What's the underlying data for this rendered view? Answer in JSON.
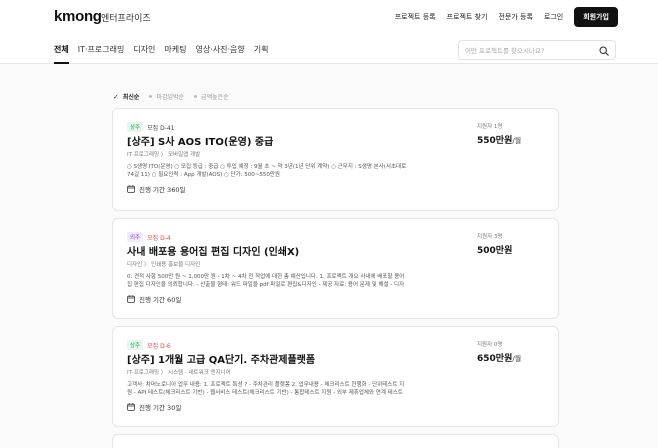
{
  "header": {
    "logo": "kmong",
    "logo_sub": "엔터프라이즈",
    "nav": [
      "프로젝트 등록",
      "프로젝트 찾기",
      "전문가 등록",
      "로그인"
    ],
    "signup": "회원가입"
  },
  "categories": [
    "전체",
    "IT·프로그래밍",
    "디자인",
    "마케팅",
    "영상·사진·음향",
    "기획"
  ],
  "search": {
    "placeholder": "어떤 프로젝트를 찾으시나요?"
  },
  "sort": [
    "최신순",
    "마감임박순",
    "금액높은순"
  ],
  "colors": {
    "accent": "#111111",
    "green": "#17a34a",
    "purple": "#8b3fd9",
    "red": "#e5484d"
  },
  "projects": [
    {
      "badge": "상주",
      "badge_color": "green",
      "dday": "모집 D-41",
      "dday_red": false,
      "title": "[상주] S사 AOS ITO(운영) 중급",
      "category": "IT·프로그래밍 〉 모바일앱 개발",
      "desc": "○ S생명 ITO(운영) ○ 모집 등급 : 중급 ○ 투입 예정 : 9월 초 ~ 약 3년(1년 단위 계약) ○ 근무지 : S생명 본사(서초대로 74길 11) ○ 필요인력 : App 개발(AOS) ○ 단가: 500~550만원",
      "period": "진행 기간 360일",
      "applicants": "지원자 1명",
      "price": "550만원",
      "price_unit": "/월"
    },
    {
      "badge": "외주",
      "badge_color": "purple",
      "dday": "모집 D-4",
      "dday_red": true,
      "title": "사내 배포용 용어집 편집 디자인 (인쇄X)",
      "category": "디자인 〉 인쇄용 홍보물 디자인",
      "desc": "0. 견적 사항 500만 원 ~ 1,000만 원 - 1차 ~ 4차 전 작업에 대한 총 예산입니다. 1. 프로젝트 개요 사내에 배포할 용어집 편집 디자인을 의뢰합니다. - 산출물 형태: 워드 파일을 pdf 파일로 편집&디자인 - 제공 자료: 용어 문제 및 해설 - 디자인 ...",
      "period": "진행 기간 60일",
      "applicants": "지원자 3명",
      "price": "500만원",
      "price_unit": ""
    },
    {
      "badge": "상주",
      "badge_color": "green",
      "dday": "모집 D-6",
      "dday_red": true,
      "title": "[상주] 1개월 고급 QA단기. 주차관제플랫폼",
      "category": "IT·프로그래밍 〉 시스템 · 네트워크 엔지니어",
      "desc": "고객사: 차머노로니아 업무 내용: 1. 프로젝트 특성 ? - 주차관리 플랫폼 2. 업무내용 - 체크리스트 현행화 - 단위테스트 지원 - API 테스트(체크리스트 기반) - 웹서비스 테스트(체크리스트 기반) - 통합테스트 지원 - 외부 제휴업체와 연계 테스트 지원 - ...",
      "period": "진행 기간 30일",
      "applicants": "지원자 0명",
      "price": "650만원",
      "price_unit": "/월"
    }
  ]
}
